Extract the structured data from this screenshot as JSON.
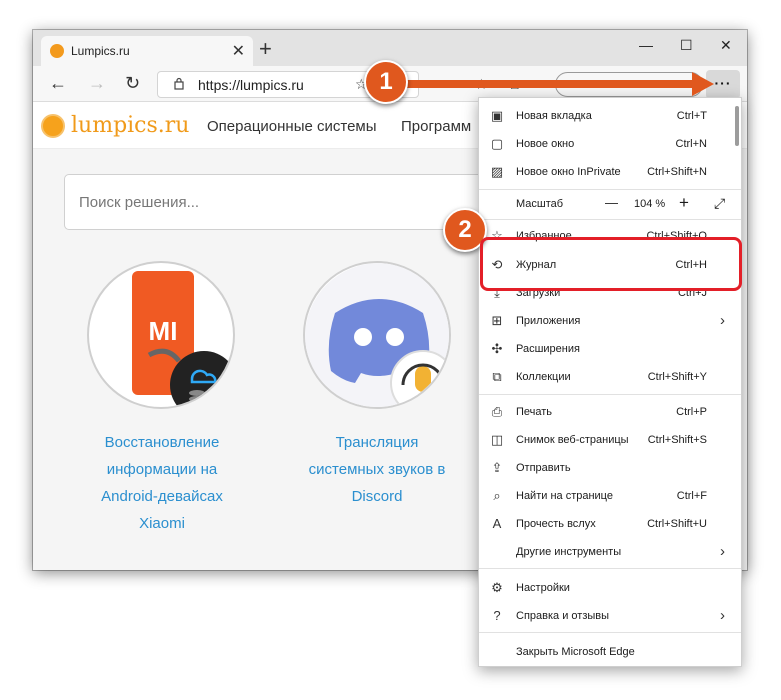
{
  "browser": {
    "tab_title": "Lumpics.ru",
    "tab_close": "✕",
    "new_tab": "+",
    "minimize": "—",
    "maximize": "☐",
    "close": "✕",
    "back": "←",
    "forward": "→",
    "refresh": "↻",
    "url": "https://lumpics.ru",
    "more_button": "···"
  },
  "site": {
    "logo": "lumpics.ru",
    "nav": [
      "Операционные системы",
      "Программ"
    ],
    "search_placeholder": "Поиск решения...",
    "cards": [
      {
        "title_lines": [
          "Восстановление",
          "информации на",
          "Android-девайсах",
          "Xiaomi"
        ]
      },
      {
        "title_lines": [
          "Трансляция",
          "системных звуков в",
          "Discord"
        ]
      }
    ]
  },
  "menu": {
    "items": [
      {
        "icon": "tab-icon",
        "label": "Новая вкладка",
        "shortcut": "Ctrl+T"
      },
      {
        "icon": "window-icon",
        "label": "Новое окно",
        "shortcut": "Ctrl+N"
      },
      {
        "icon": "inprivate-icon",
        "label": "Новое окно InPrivate",
        "shortcut": "Ctrl+Shift+N"
      },
      {
        "label": "Масштаб",
        "zoom_minus": "—",
        "zoom_value": "104 %",
        "zoom_plus": "+",
        "fullscreen": "⤢"
      },
      {
        "icon": "star-icon",
        "label": "Избранное",
        "shortcut": "Ctrl+Shift+O"
      },
      {
        "icon": "history-icon",
        "label": "Журнал",
        "shortcut": "Ctrl+H"
      },
      {
        "icon": "download-icon",
        "label": "Загрузки",
        "shortcut": "Ctrl+J"
      },
      {
        "icon": "apps-icon",
        "label": "Приложения",
        "arrow": "›"
      },
      {
        "icon": "extensions-icon",
        "label": "Расширения"
      },
      {
        "icon": "collections-icon",
        "label": "Коллекции",
        "shortcut": "Ctrl+Shift+Y"
      },
      {
        "icon": "print-icon",
        "label": "Печать",
        "shortcut": "Ctrl+P"
      },
      {
        "icon": "screenshot-icon",
        "label": "Снимок веб-страницы",
        "shortcut": "Ctrl+Shift+S"
      },
      {
        "icon": "share-icon",
        "label": "Отправить"
      },
      {
        "icon": "find-icon",
        "label": "Найти на странице",
        "shortcut": "Ctrl+F"
      },
      {
        "icon": "read-aloud-icon",
        "label": "Прочесть вслух",
        "shortcut": "Ctrl+Shift+U"
      },
      {
        "label": "Другие инструменты",
        "arrow": "›"
      },
      {
        "icon": "gear-icon",
        "label": "Настройки"
      },
      {
        "icon": "help-icon",
        "label": "Справка и отзывы",
        "arrow": "›"
      },
      {
        "label": "Закрыть Microsoft Edge"
      }
    ]
  },
  "callouts": [
    "1",
    "2"
  ],
  "colors": {
    "accent": "#e0581e",
    "highlight": "#e31f28",
    "link": "#2b8fcf",
    "logo": "#f09a1a"
  }
}
